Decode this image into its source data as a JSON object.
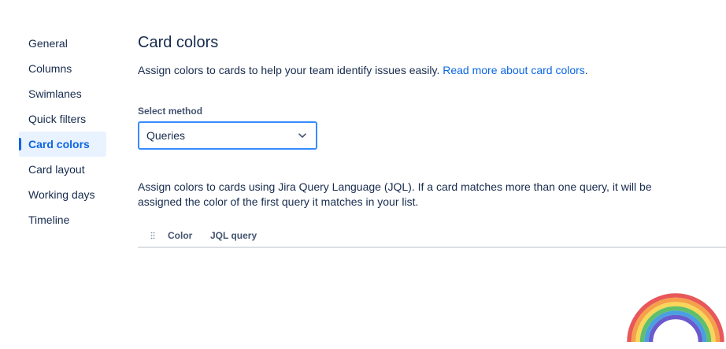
{
  "sidebar": {
    "items": [
      {
        "label": "General"
      },
      {
        "label": "Columns"
      },
      {
        "label": "Swimlanes"
      },
      {
        "label": "Quick filters"
      },
      {
        "label": "Card colors",
        "active": true
      },
      {
        "label": "Card layout"
      },
      {
        "label": "Working days"
      },
      {
        "label": "Timeline"
      }
    ]
  },
  "main": {
    "title": "Card colors",
    "description": "Assign colors to cards to help your team identify issues easily.",
    "read_more_link": "Read more about card colors",
    "description_end": ".",
    "select_label": "Select method",
    "select_value": "Queries",
    "info_text": "Assign colors to cards using Jira Query Language (JQL). If a card matches more than one query, it will be assigned the color of the first query it matches in your list.",
    "table": {
      "columns": [
        "Color",
        "JQL query"
      ]
    }
  },
  "colors": {
    "accent": "#0c66e4",
    "text": "#172b4d",
    "active_bg": "#e9f2ff",
    "focus_border": "#388bff"
  },
  "icons": {
    "select_chevron": "chevron-down-icon",
    "drag_handle": "drag-handle-icon",
    "corner_graphic": "rainbow-icon"
  }
}
